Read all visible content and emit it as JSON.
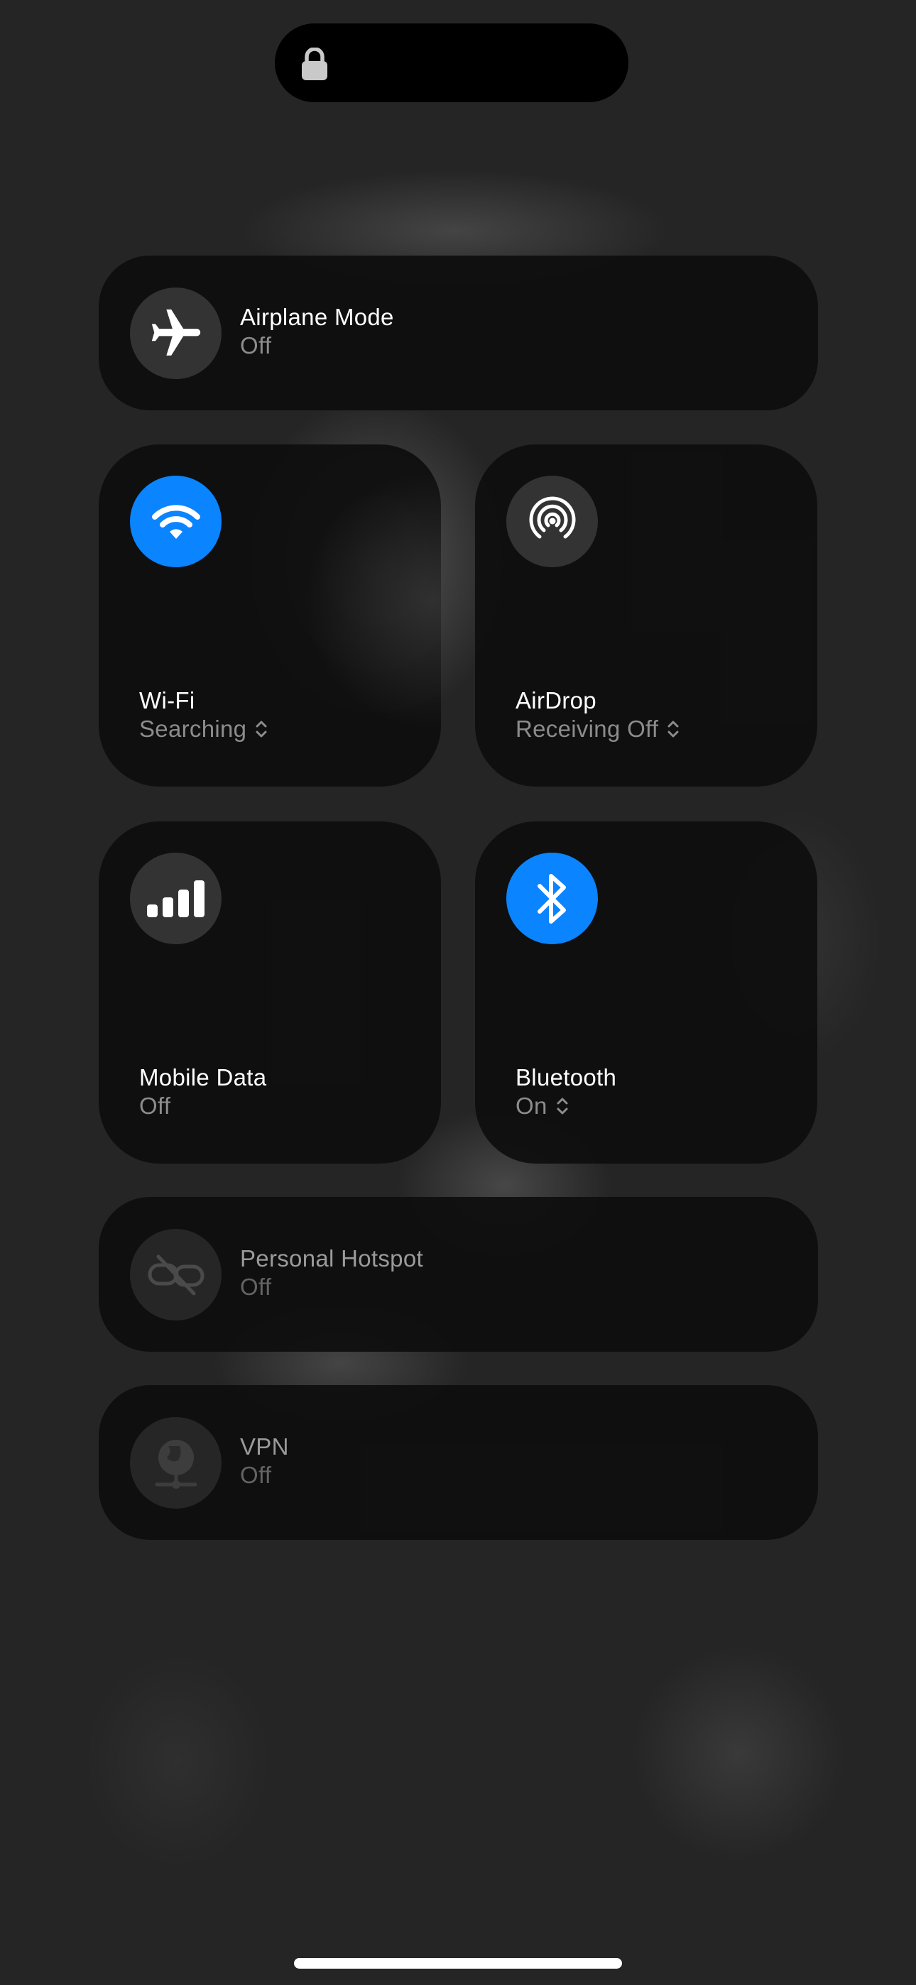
{
  "colors": {
    "accent": "#0a84ff",
    "background": "#252525",
    "tile": "#0e0e0e"
  },
  "status_bar": {
    "icon": "lock-icon"
  },
  "controls": {
    "airplane": {
      "title": "Airplane Mode",
      "status": "Off",
      "icon": "airplane-icon",
      "active": false
    },
    "wifi": {
      "title": "Wi-Fi",
      "status": "Searching",
      "icon": "wifi-icon",
      "active": true
    },
    "airdrop": {
      "title": "AirDrop",
      "status": "Receiving Off",
      "icon": "airdrop-icon",
      "active": false
    },
    "mobile_data": {
      "title": "Mobile Data",
      "status": "Off",
      "icon": "cellular-signal-icon",
      "active": false
    },
    "bluetooth": {
      "title": "Bluetooth",
      "status": "On",
      "icon": "bluetooth-icon",
      "active": true
    },
    "hotspot": {
      "title": "Personal Hotspot",
      "status": "Off",
      "icon": "hotspot-link-icon",
      "active": false
    },
    "vpn": {
      "title": "VPN",
      "status": "Off",
      "icon": "vpn-globe-icon",
      "active": false
    }
  }
}
